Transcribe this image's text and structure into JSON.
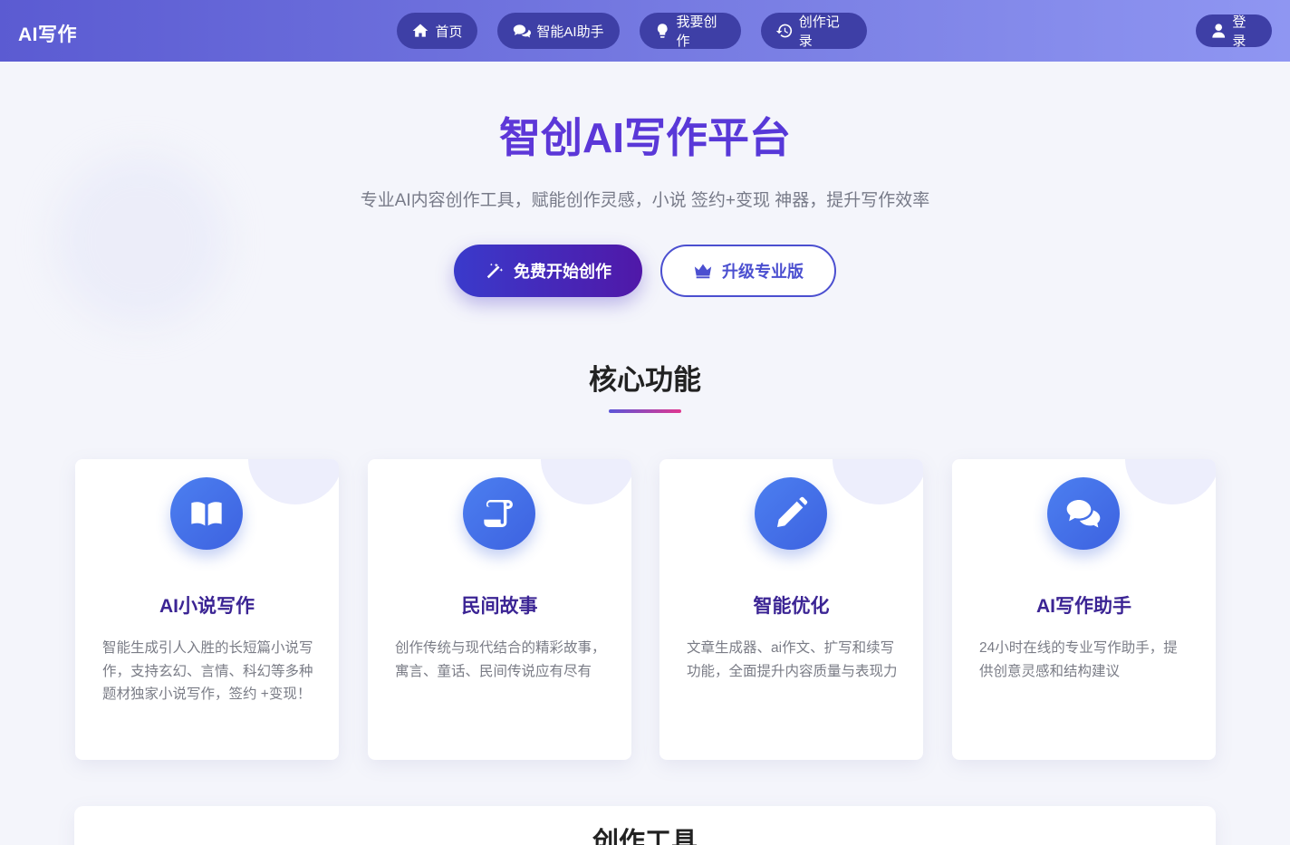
{
  "header": {
    "logo": "AI写作",
    "nav": [
      {
        "label": "首页",
        "icon": "home-icon"
      },
      {
        "label": "智能AI助手",
        "icon": "chat-icon"
      },
      {
        "label": "我要创作",
        "icon": "lightbulb-icon"
      },
      {
        "label": "创作记录",
        "icon": "history-icon"
      }
    ],
    "login": {
      "label": "登录",
      "icon": "user-icon"
    }
  },
  "hero": {
    "title": "智创AI写作平台",
    "subtitle": "专业AI内容创作工具，赋能创作灵感，小说 签约+变现 神器，提升写作效率",
    "primary_button": "免费开始创作",
    "secondary_button": "升级专业版"
  },
  "features": {
    "title": "核心功能",
    "cards": [
      {
        "title": "AI小说写作",
        "desc": "智能生成引人入胜的长短篇小说写作，支持玄幻、言情、科幻等多种题材独家小说写作，签约 +变现！",
        "icon": "book-icon"
      },
      {
        "title": "民间故事",
        "desc": "创作传统与现代结合的精彩故事，寓言、童话、民间传说应有尽有",
        "icon": "scroll-icon"
      },
      {
        "title": "智能优化",
        "desc": "文章生成器、ai作文、扩写和续写功能，全面提升内容质量与表现力",
        "icon": "pencil-icon"
      },
      {
        "title": "AI写作助手",
        "desc": "24小时在线的专业写作助手，提供创意灵感和结构建议",
        "icon": "comments-icon"
      }
    ]
  },
  "tools": {
    "title": "创作工具"
  },
  "colors": {
    "accent": "#4b4fd0",
    "header_start": "#5b5bd2",
    "header_end": "#8f96f2",
    "title_purple": "#5b2fd6",
    "icon_blue": "#4c7ff0"
  }
}
